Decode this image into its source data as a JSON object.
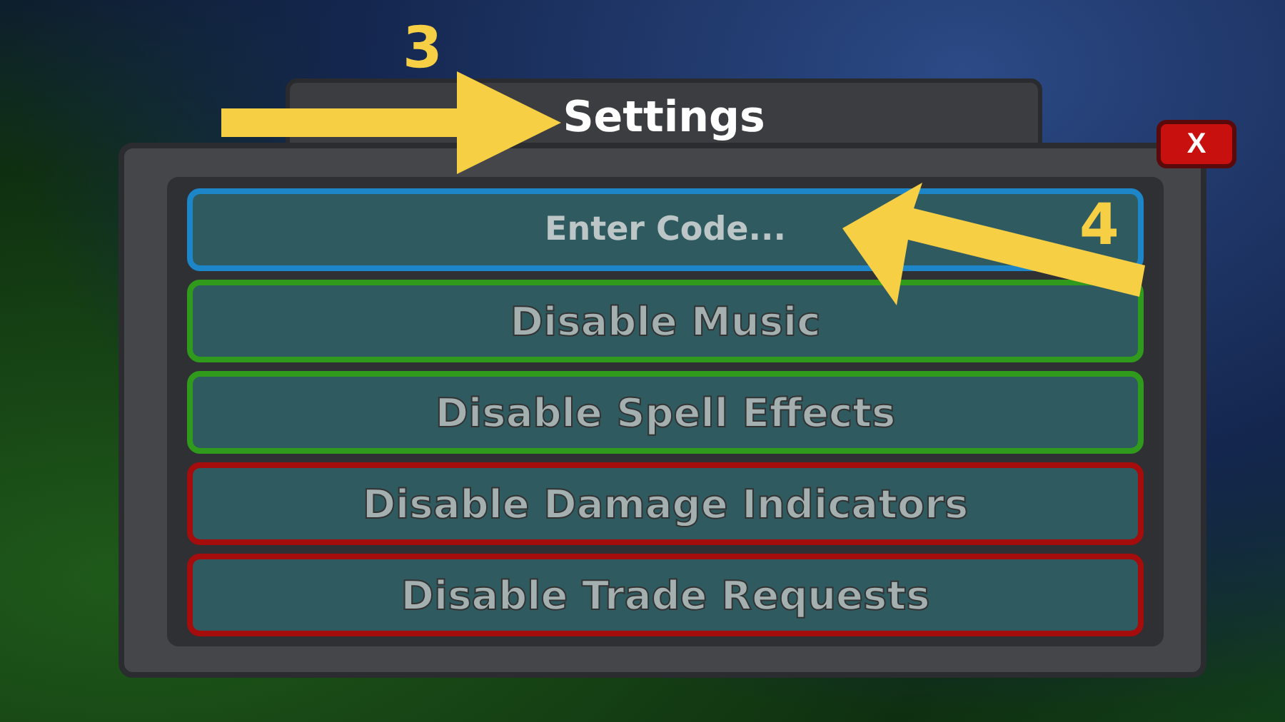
{
  "window": {
    "title": "Settings"
  },
  "close_button": {
    "label": "X"
  },
  "options": [
    {
      "kind": "textbox",
      "placeholder": "Enter Code...",
      "color": "#1c86c8"
    },
    {
      "kind": "toggle",
      "label": "Disable Music",
      "color": "#2f9a1c"
    },
    {
      "kind": "toggle",
      "label": "Disable Spell Effects",
      "color": "#2f9a1c"
    },
    {
      "kind": "toggle",
      "label": "Disable Damage Indicators",
      "color": "#a50c0c"
    },
    {
      "kind": "toggle",
      "label": "Disable Trade Requests",
      "color": "#a50c0c"
    }
  ],
  "annotations": [
    {
      "label": "3"
    },
    {
      "label": "4"
    }
  ]
}
